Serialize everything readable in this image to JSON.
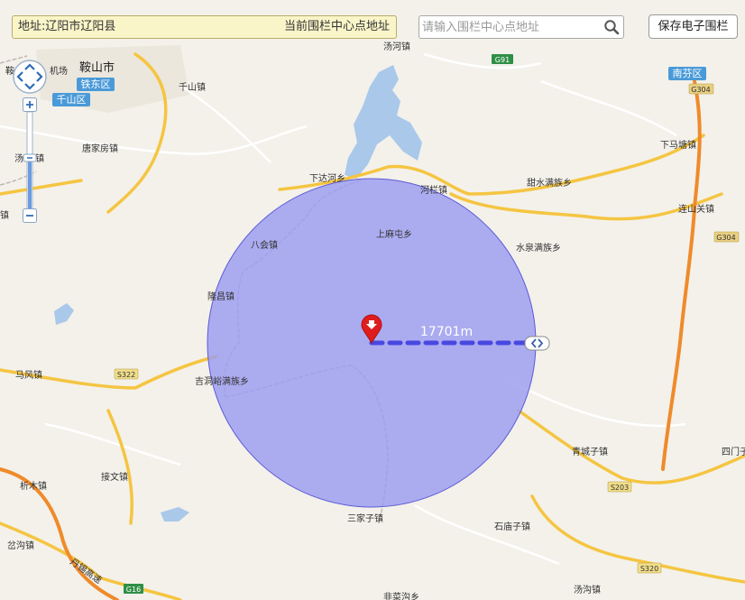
{
  "address_bar": {
    "address": "地址:辽阳市辽阳县",
    "hint": "当前围栏中心点地址"
  },
  "search": {
    "placeholder": "请输入围栏中心点地址",
    "value": ""
  },
  "save_button": "保存电子围栏",
  "fence": {
    "radius_label": "17701m",
    "fill_color": "#9b9bf2",
    "stroke_color": "#5b5bd6"
  },
  "places": {
    "anshan": "鞍山市",
    "tiedong": "铁东区",
    "qianshan_qu": "千山区",
    "qianshan_zhen": "千山镇",
    "tanghe_zhen": "汤河镇",
    "tangjiafang": "唐家房镇",
    "xiadahe": "下达河乡",
    "helan": "河栏镇",
    "tianshui": "甜水满族乡",
    "xiamatang": "下马塘镇",
    "nanfen": "南芬区",
    "lianshanguan": "连山关镇",
    "bahui": "八会镇",
    "shangmatun": "上麻屯乡",
    "shuiquan": "水泉满族乡",
    "longchang": "隆昌镇",
    "mafeng": "马风镇",
    "jidongyu": "吉洞峪满族乡",
    "qingchengzi": "青城子镇",
    "simenzi": "四门子",
    "jiewen": "接文镇",
    "ximu": "析木镇",
    "sanjiazi": "三家子镇",
    "shimiaozi": "石庙子镇",
    "tangchi": "岔沟镇",
    "tanggou": "汤沟镇",
    "feicaogou": "非菜沟乡",
    "tangzi_left": "汤 子镇",
    "jichang": "机场",
    "left_zhen": "镇",
    "anshan_left": "鞍"
  },
  "road_shields": {
    "g91": "G91",
    "g304a": "G304",
    "g304b": "G304",
    "s322": "S322",
    "s203": "S203",
    "s320": "S320",
    "g16": "G16"
  },
  "road_names": {
    "danxi": "丹锡高速"
  },
  "colors": {
    "major_road": "#f5c542",
    "highway": "#f08a2a",
    "water": "#a9c8ea",
    "land": "#f3f1ea"
  }
}
